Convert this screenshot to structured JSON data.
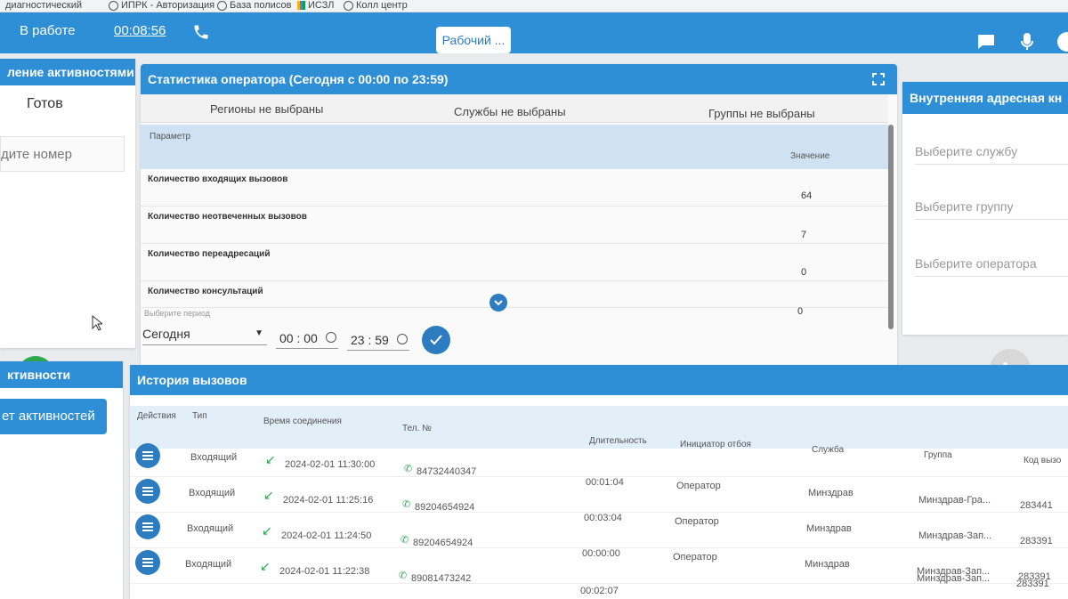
{
  "bookmarks": [
    {
      "label": "диагностический"
    },
    {
      "label": "ИПРК - Авторизация"
    },
    {
      "label": "База полисов"
    },
    {
      "label": "ИСЗЛ"
    },
    {
      "label": "Колл центр"
    }
  ],
  "topbar": {
    "status": "В работе",
    "timer": "00:08:56",
    "mode": "Рабочий ..."
  },
  "left_panel": {
    "title": "ление активностями",
    "ready": "Готов",
    "number_placeholder": "дите номер"
  },
  "left_panel2": {
    "title": "ктивности",
    "button": "ет активностей"
  },
  "stats": {
    "title": "Статистика оператора (Сегодня с 00:00 по 23:59)",
    "filters": [
      "Регионы не выбраны",
      "Службы не выбраны",
      "Группы не выбраны"
    ],
    "param_header": "Параметр",
    "value_header": "Значение",
    "rows": [
      {
        "name": "Количество входящих вызовов",
        "value": "64"
      },
      {
        "name": "Количество неотвеченных вызовов",
        "value": "7"
      },
      {
        "name": "Количество переадресаций",
        "value": "0"
      },
      {
        "name": "Количество консультаций",
        "value": "0"
      }
    ],
    "period_label": "Выберите период",
    "period_value": "Сегодня",
    "time_from": "00 : 00",
    "time_to": "23 : 59"
  },
  "address_book": {
    "title": "Внутренняя адресная кн",
    "service": "Выберите службу",
    "group": "Выберите группу",
    "operator": "Выберите оператора"
  },
  "history": {
    "title": "История вызовов",
    "columns": [
      "Действия",
      "Тип",
      "Время соединения",
      "Тел. №",
      "Длительность",
      "Инициатор отбоя",
      "Служба",
      "Группа",
      "Код вызо"
    ],
    "rows": [
      {
        "type": "Входящий",
        "time": "2024-02-01 11:30:00",
        "phone": "84732440347",
        "duration": "00:01:04",
        "initiator": "Оператор",
        "service": "Минздрав",
        "group": "Минздрав-Гра...",
        "code": "283441"
      },
      {
        "type": "Входящий",
        "time": "2024-02-01 11:25:16",
        "phone": "89204654924",
        "duration": "00:03:04",
        "initiator": "Оператор",
        "service": "Минздрав",
        "group": "Минздрав-Зап...",
        "code": "283391"
      },
      {
        "type": "Входящий",
        "time": "2024-02-01 11:24:50",
        "phone": "89204654924",
        "duration": "00:00:00",
        "initiator": "Оператор",
        "service": "Минздрав",
        "group": "Минздрав-Зап...",
        "code": "283391"
      },
      {
        "type": "Входящий",
        "time": "2024-02-01 11:22:38",
        "phone": "89081473242",
        "duration": "00:02:07",
        "initiator": "",
        "service": "",
        "group": "Минздрав-Зап...",
        "code": "283391"
      }
    ]
  },
  "colors": {
    "primary": "#2e8fd6",
    "button": "#2e7cc0",
    "call_green": "#2fa84f"
  }
}
